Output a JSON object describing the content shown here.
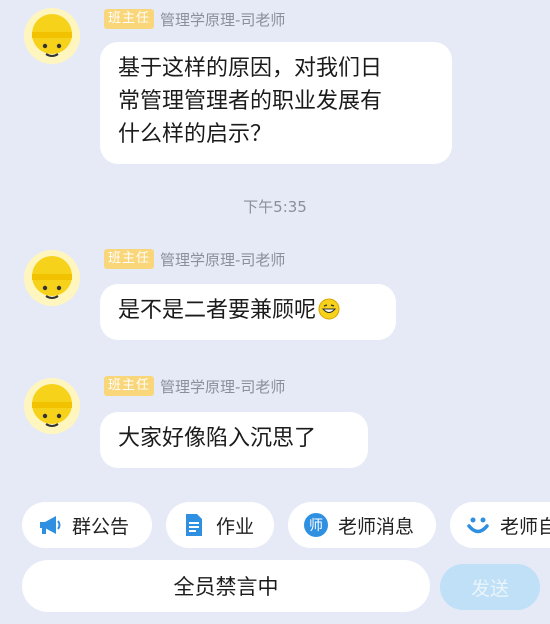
{
  "messages": [
    {
      "badge": "班主任",
      "sender": "管理学原理-司老师",
      "lines": [
        "基于这样的原因，对我们日",
        "常管理管理者的职业发展有",
        "什么样的启示？"
      ]
    },
    {
      "badge": "班主任",
      "sender": "管理学原理-司老师",
      "lines": [
        "是不是二者要兼顾呢"
      ],
      "emoji": "grinning-face-emoji"
    },
    {
      "badge": "班主任",
      "sender": "管理学原理-司老师",
      "lines": [
        "大家好像陷入沉思了"
      ]
    }
  ],
  "timestamp": "下午5:35",
  "shortcuts": [
    {
      "label": "群公告",
      "icon": "megaphone-icon",
      "color": "#2f8fe0"
    },
    {
      "label": "作业",
      "icon": "document-icon",
      "color": "#2f8fe0"
    },
    {
      "label": "老师消息",
      "icon": "teacher-icon",
      "color": "#2f8fe0"
    },
    {
      "label": "老师自",
      "icon": "smile-icon",
      "color": "#2f8fe0"
    }
  ],
  "input": {
    "placeholder": "全员禁言中"
  },
  "send_label": "发送",
  "colors": {
    "background": "#e6eaf6",
    "badge": "#f9d67a",
    "send_button": "#bfe0f6",
    "accent_blue": "#2f8fe0"
  }
}
